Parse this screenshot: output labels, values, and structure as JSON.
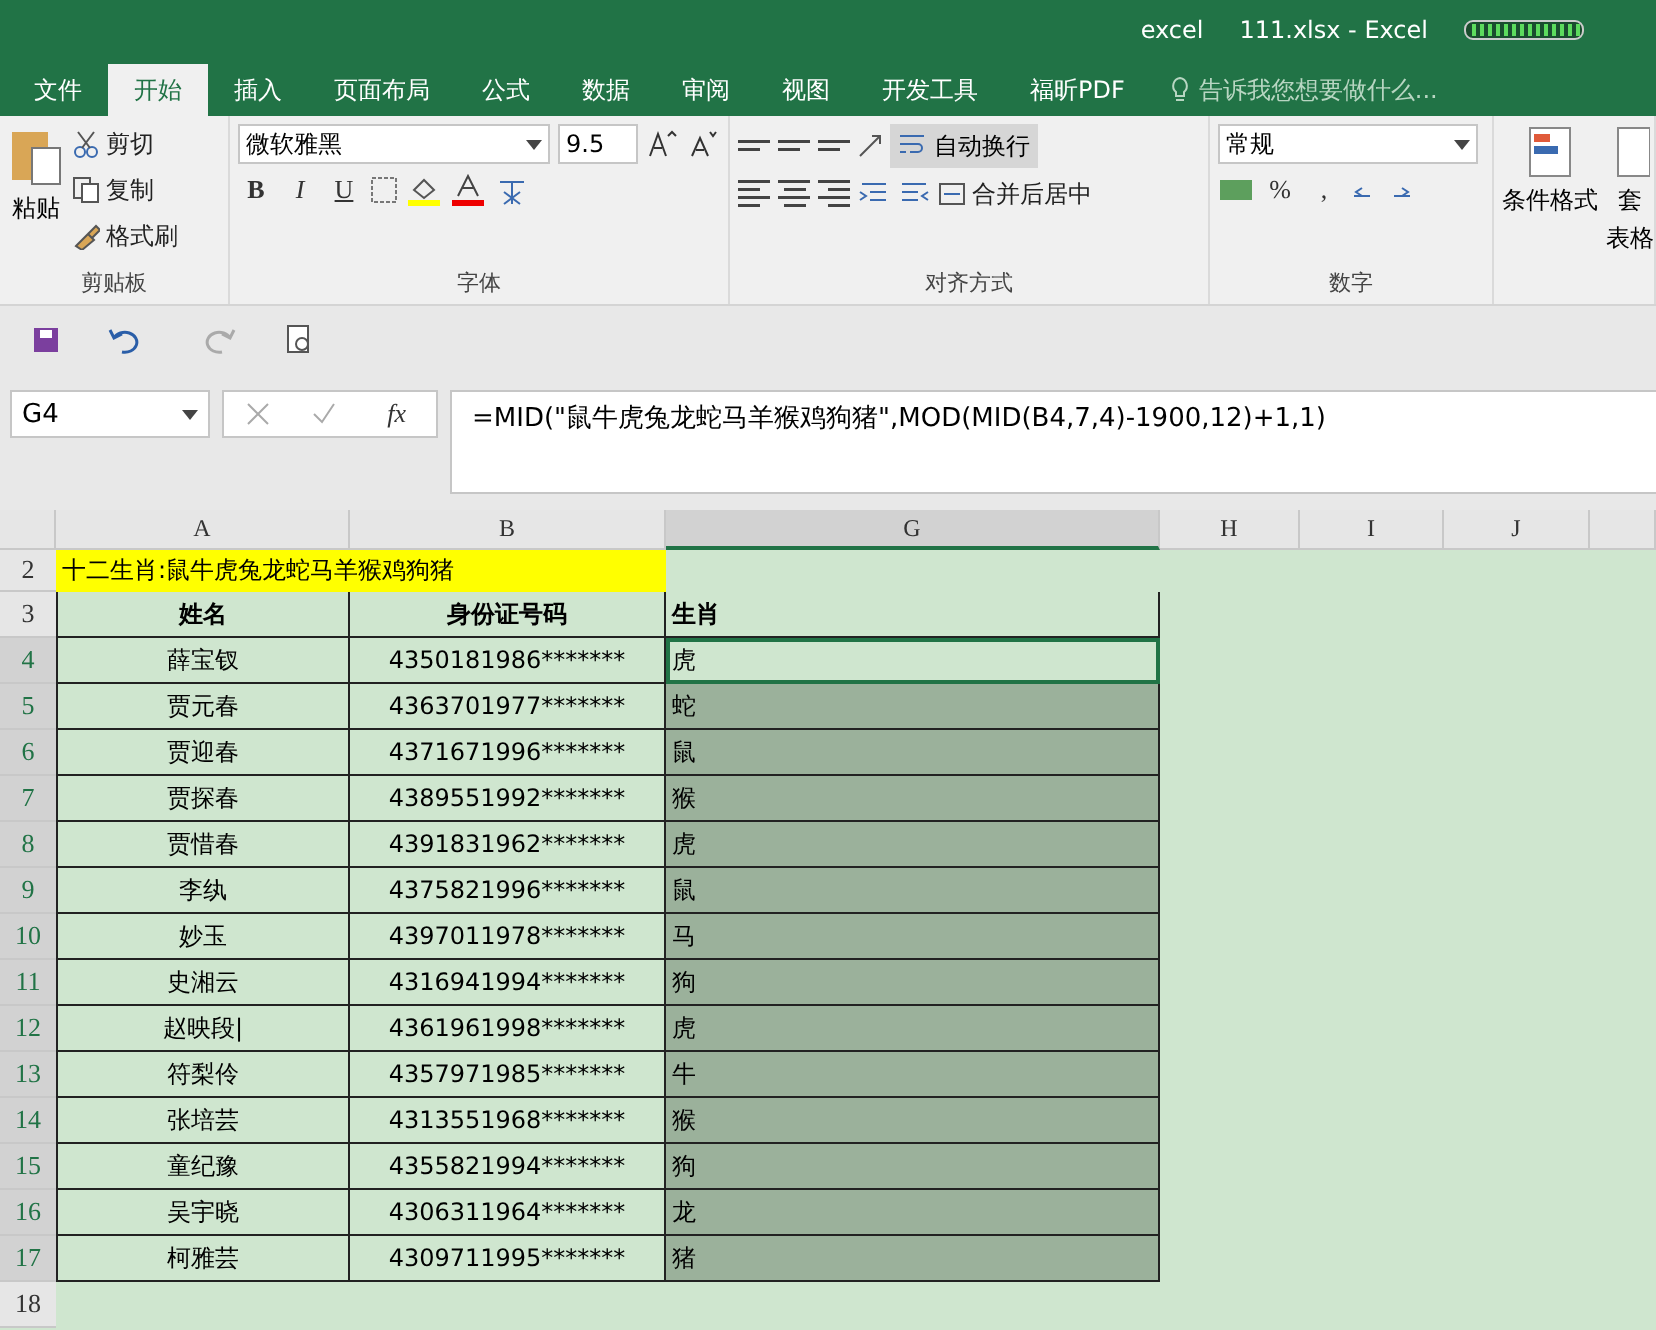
{
  "window": {
    "app": "excel",
    "title": "111.xlsx - Excel"
  },
  "tabs": [
    {
      "label": "文件",
      "selected": false
    },
    {
      "label": "开始",
      "selected": true
    },
    {
      "label": "插入",
      "selected": false
    },
    {
      "label": "页面布局",
      "selected": false
    },
    {
      "label": "公式",
      "selected": false
    },
    {
      "label": "数据",
      "selected": false
    },
    {
      "label": "审阅",
      "selected": false
    },
    {
      "label": "视图",
      "selected": false
    },
    {
      "label": "开发工具",
      "selected": false
    },
    {
      "label": "福昕PDF",
      "selected": false
    }
  ],
  "tell_me": {
    "placeholder": "告诉我您想要做什么..."
  },
  "ribbon": {
    "clipboard": {
      "paste": "粘贴",
      "cut": "剪切",
      "copy": "复制",
      "format_painter": "格式刷",
      "label": "剪贴板"
    },
    "font": {
      "name": "微软雅黑",
      "size": "9.5",
      "bold": "B",
      "italic": "I",
      "underline": "U",
      "label": "字体"
    },
    "alignment": {
      "wrap": "自动换行",
      "merge": "合并后居中",
      "label": "对齐方式"
    },
    "number": {
      "format": "常规",
      "percent": "%",
      "comma": ",",
      "label": "数字"
    },
    "styles": {
      "conditional": "条件格式",
      "table_1": "套",
      "table_2": "表格"
    }
  },
  "formula_bar": {
    "name_box": "G4",
    "fx": "fx",
    "formula": "=MID(\"鼠牛虎兔龙蛇马羊猴鸡狗猪\",MOD(MID(B4,7,4)-1900,12)+1,1)"
  },
  "sheet": {
    "columns": [
      {
        "label": "A",
        "selected": false
      },
      {
        "label": "B",
        "selected": false
      },
      {
        "label": "G",
        "selected": true
      },
      {
        "label": "H",
        "selected": false
      },
      {
        "label": "I",
        "selected": false
      },
      {
        "label": "J",
        "selected": false
      }
    ],
    "title_row": {
      "row": "2",
      "text": "十二生肖:鼠牛虎兔龙蛇马羊猴鸡狗猪"
    },
    "header_row": {
      "row": "3",
      "cells": [
        "姓名",
        "身份证号码",
        "生肖"
      ]
    },
    "rows": [
      {
        "row": "4",
        "name": "薛宝钗",
        "id": "4350181986*******",
        "zodiac": "虎",
        "selected": false
      },
      {
        "row": "5",
        "name": "贾元春",
        "id": "4363701977*******",
        "zodiac": "蛇",
        "selected": true
      },
      {
        "row": "6",
        "name": "贾迎春",
        "id": "4371671996*******",
        "zodiac": "鼠",
        "selected": true
      },
      {
        "row": "7",
        "name": "贾探春",
        "id": "4389551992*******",
        "zodiac": "猴",
        "selected": true
      },
      {
        "row": "8",
        "name": "贾惜春",
        "id": "4391831962*******",
        "zodiac": "虎",
        "selected": true
      },
      {
        "row": "9",
        "name": "李纨",
        "id": "4375821996*******",
        "zodiac": "鼠",
        "selected": true
      },
      {
        "row": "10",
        "name": "妙玉",
        "id": "4397011978*******",
        "zodiac": "马",
        "selected": true
      },
      {
        "row": "11",
        "name": "史湘云",
        "id": "4316941994*******",
        "zodiac": "狗",
        "selected": true
      },
      {
        "row": "12",
        "name": "赵映段|",
        "id": "4361961998*******",
        "zodiac": "虎",
        "selected": true
      },
      {
        "row": "13",
        "name": "符梨伶",
        "id": "4357971985*******",
        "zodiac": "牛",
        "selected": true
      },
      {
        "row": "14",
        "name": "张培芸",
        "id": "4313551968*******",
        "zodiac": "猴",
        "selected": true
      },
      {
        "row": "15",
        "name": "童纪豫",
        "id": "4355821994*******",
        "zodiac": "狗",
        "selected": true
      },
      {
        "row": "16",
        "name": "吴宇晓",
        "id": "4306311964*******",
        "zodiac": "龙",
        "selected": true
      },
      {
        "row": "17",
        "name": "柯雅芸",
        "id": "4309711995*******",
        "zodiac": "猪",
        "selected": true
      }
    ],
    "empty_row": "18"
  }
}
